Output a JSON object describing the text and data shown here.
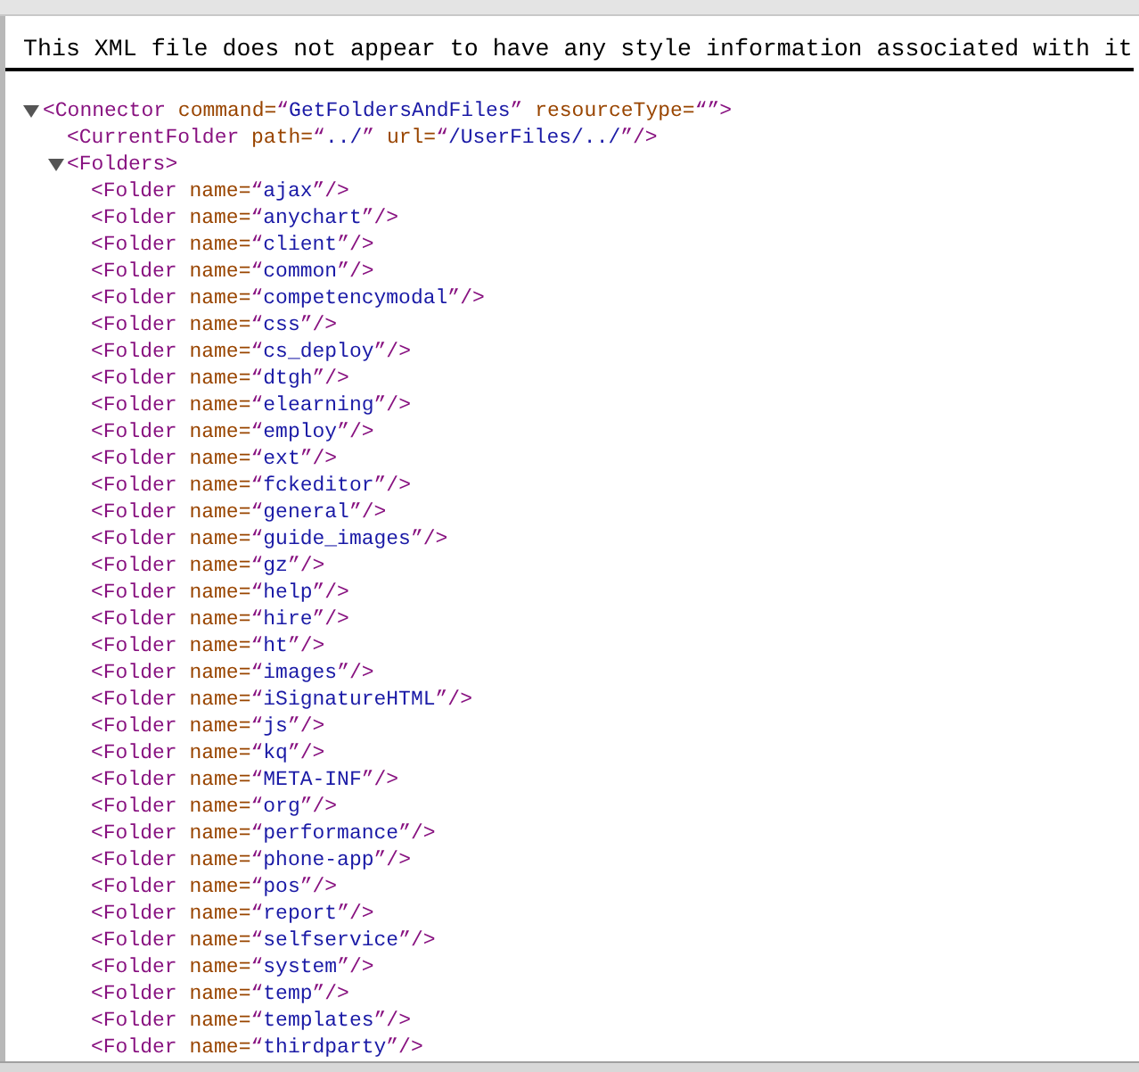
{
  "notice": "This XML file does not appear to have any style information associated with it",
  "tree": [
    {
      "expanded": true,
      "tokens": [
        {
          "kind": "tag",
          "text": "<Connector"
        },
        {
          "kind": "attr",
          "text": " command="
        },
        {
          "kind": "tag",
          "text": "“"
        },
        {
          "kind": "value",
          "text": "GetFoldersAndFiles"
        },
        {
          "kind": "tag",
          "text": "”"
        },
        {
          "kind": "attr",
          "text": " resourceType="
        },
        {
          "kind": "tag",
          "text": "“”>"
        }
      ],
      "children": [
        {
          "tokens": [
            {
              "kind": "tag",
              "text": "<CurrentFolder"
            },
            {
              "kind": "attr",
              "text": " path="
            },
            {
              "kind": "tag",
              "text": "“"
            },
            {
              "kind": "value",
              "text": "../"
            },
            {
              "kind": "tag",
              "text": "”"
            },
            {
              "kind": "attr",
              "text": " url="
            },
            {
              "kind": "tag",
              "text": "“"
            },
            {
              "kind": "value",
              "text": "/UserFiles/../"
            },
            {
              "kind": "tag",
              "text": "”/>"
            }
          ]
        },
        {
          "expanded": true,
          "tokens": [
            {
              "kind": "tag",
              "text": "<Folders>"
            }
          ],
          "children": [
            {
              "tokens": [
                {
                  "kind": "tag",
                  "text": "<Folder"
                },
                {
                  "kind": "attr",
                  "text": " name="
                },
                {
                  "kind": "tag",
                  "text": "“"
                },
                {
                  "kind": "value",
                  "text": "ajax"
                },
                {
                  "kind": "tag",
                  "text": "”/>"
                }
              ]
            },
            {
              "tokens": [
                {
                  "kind": "tag",
                  "text": "<Folder"
                },
                {
                  "kind": "attr",
                  "text": " name="
                },
                {
                  "kind": "tag",
                  "text": "“"
                },
                {
                  "kind": "value",
                  "text": "anychart"
                },
                {
                  "kind": "tag",
                  "text": "”/>"
                }
              ]
            },
            {
              "tokens": [
                {
                  "kind": "tag",
                  "text": "<Folder"
                },
                {
                  "kind": "attr",
                  "text": " name="
                },
                {
                  "kind": "tag",
                  "text": "“"
                },
                {
                  "kind": "value",
                  "text": "client"
                },
                {
                  "kind": "tag",
                  "text": "”/>"
                }
              ]
            },
            {
              "tokens": [
                {
                  "kind": "tag",
                  "text": "<Folder"
                },
                {
                  "kind": "attr",
                  "text": " name="
                },
                {
                  "kind": "tag",
                  "text": "“"
                },
                {
                  "kind": "value",
                  "text": "common"
                },
                {
                  "kind": "tag",
                  "text": "”/>"
                }
              ]
            },
            {
              "tokens": [
                {
                  "kind": "tag",
                  "text": "<Folder"
                },
                {
                  "kind": "attr",
                  "text": " name="
                },
                {
                  "kind": "tag",
                  "text": "“"
                },
                {
                  "kind": "value",
                  "text": "competencymodal"
                },
                {
                  "kind": "tag",
                  "text": "”/>"
                }
              ]
            },
            {
              "tokens": [
                {
                  "kind": "tag",
                  "text": "<Folder"
                },
                {
                  "kind": "attr",
                  "text": " name="
                },
                {
                  "kind": "tag",
                  "text": "“"
                },
                {
                  "kind": "value",
                  "text": "css"
                },
                {
                  "kind": "tag",
                  "text": "”/>"
                }
              ]
            },
            {
              "tokens": [
                {
                  "kind": "tag",
                  "text": "<Folder"
                },
                {
                  "kind": "attr",
                  "text": " name="
                },
                {
                  "kind": "tag",
                  "text": "“"
                },
                {
                  "kind": "value",
                  "text": "cs_deploy"
                },
                {
                  "kind": "tag",
                  "text": "”/>"
                }
              ]
            },
            {
              "tokens": [
                {
                  "kind": "tag",
                  "text": "<Folder"
                },
                {
                  "kind": "attr",
                  "text": " name="
                },
                {
                  "kind": "tag",
                  "text": "“"
                },
                {
                  "kind": "value",
                  "text": "dtgh"
                },
                {
                  "kind": "tag",
                  "text": "”/>"
                }
              ]
            },
            {
              "tokens": [
                {
                  "kind": "tag",
                  "text": "<Folder"
                },
                {
                  "kind": "attr",
                  "text": " name="
                },
                {
                  "kind": "tag",
                  "text": "“"
                },
                {
                  "kind": "value",
                  "text": "elearning"
                },
                {
                  "kind": "tag",
                  "text": "”/>"
                }
              ]
            },
            {
              "tokens": [
                {
                  "kind": "tag",
                  "text": "<Folder"
                },
                {
                  "kind": "attr",
                  "text": " name="
                },
                {
                  "kind": "tag",
                  "text": "“"
                },
                {
                  "kind": "value",
                  "text": "employ"
                },
                {
                  "kind": "tag",
                  "text": "”/>"
                }
              ]
            },
            {
              "tokens": [
                {
                  "kind": "tag",
                  "text": "<Folder"
                },
                {
                  "kind": "attr",
                  "text": " name="
                },
                {
                  "kind": "tag",
                  "text": "“"
                },
                {
                  "kind": "value",
                  "text": "ext"
                },
                {
                  "kind": "tag",
                  "text": "”/>"
                }
              ]
            },
            {
              "tokens": [
                {
                  "kind": "tag",
                  "text": "<Folder"
                },
                {
                  "kind": "attr",
                  "text": " name="
                },
                {
                  "kind": "tag",
                  "text": "“"
                },
                {
                  "kind": "value",
                  "text": "fckeditor"
                },
                {
                  "kind": "tag",
                  "text": "”/>"
                }
              ]
            },
            {
              "tokens": [
                {
                  "kind": "tag",
                  "text": "<Folder"
                },
                {
                  "kind": "attr",
                  "text": " name="
                },
                {
                  "kind": "tag",
                  "text": "“"
                },
                {
                  "kind": "value",
                  "text": "general"
                },
                {
                  "kind": "tag",
                  "text": "”/>"
                }
              ]
            },
            {
              "tokens": [
                {
                  "kind": "tag",
                  "text": "<Folder"
                },
                {
                  "kind": "attr",
                  "text": " name="
                },
                {
                  "kind": "tag",
                  "text": "“"
                },
                {
                  "kind": "value",
                  "text": "guide_images"
                },
                {
                  "kind": "tag",
                  "text": "”/>"
                }
              ]
            },
            {
              "tokens": [
                {
                  "kind": "tag",
                  "text": "<Folder"
                },
                {
                  "kind": "attr",
                  "text": " name="
                },
                {
                  "kind": "tag",
                  "text": "“"
                },
                {
                  "kind": "value",
                  "text": "gz"
                },
                {
                  "kind": "tag",
                  "text": "”/>"
                }
              ]
            },
            {
              "tokens": [
                {
                  "kind": "tag",
                  "text": "<Folder"
                },
                {
                  "kind": "attr",
                  "text": " name="
                },
                {
                  "kind": "tag",
                  "text": "“"
                },
                {
                  "kind": "value",
                  "text": "help"
                },
                {
                  "kind": "tag",
                  "text": "”/>"
                }
              ]
            },
            {
              "tokens": [
                {
                  "kind": "tag",
                  "text": "<Folder"
                },
                {
                  "kind": "attr",
                  "text": " name="
                },
                {
                  "kind": "tag",
                  "text": "“"
                },
                {
                  "kind": "value",
                  "text": "hire"
                },
                {
                  "kind": "tag",
                  "text": "”/>"
                }
              ]
            },
            {
              "tokens": [
                {
                  "kind": "tag",
                  "text": "<Folder"
                },
                {
                  "kind": "attr",
                  "text": " name="
                },
                {
                  "kind": "tag",
                  "text": "“"
                },
                {
                  "kind": "value",
                  "text": "ht"
                },
                {
                  "kind": "tag",
                  "text": "”/>"
                }
              ]
            },
            {
              "tokens": [
                {
                  "kind": "tag",
                  "text": "<Folder"
                },
                {
                  "kind": "attr",
                  "text": " name="
                },
                {
                  "kind": "tag",
                  "text": "“"
                },
                {
                  "kind": "value",
                  "text": "images"
                },
                {
                  "kind": "tag",
                  "text": "”/>"
                }
              ]
            },
            {
              "tokens": [
                {
                  "kind": "tag",
                  "text": "<Folder"
                },
                {
                  "kind": "attr",
                  "text": " name="
                },
                {
                  "kind": "tag",
                  "text": "“"
                },
                {
                  "kind": "value",
                  "text": "iSignatureHTML"
                },
                {
                  "kind": "tag",
                  "text": "”/>"
                }
              ]
            },
            {
              "tokens": [
                {
                  "kind": "tag",
                  "text": "<Folder"
                },
                {
                  "kind": "attr",
                  "text": " name="
                },
                {
                  "kind": "tag",
                  "text": "“"
                },
                {
                  "kind": "value",
                  "text": "js"
                },
                {
                  "kind": "tag",
                  "text": "”/>"
                }
              ]
            },
            {
              "tokens": [
                {
                  "kind": "tag",
                  "text": "<Folder"
                },
                {
                  "kind": "attr",
                  "text": " name="
                },
                {
                  "kind": "tag",
                  "text": "“"
                },
                {
                  "kind": "value",
                  "text": "kq"
                },
                {
                  "kind": "tag",
                  "text": "”/>"
                }
              ]
            },
            {
              "tokens": [
                {
                  "kind": "tag",
                  "text": "<Folder"
                },
                {
                  "kind": "attr",
                  "text": " name="
                },
                {
                  "kind": "tag",
                  "text": "“"
                },
                {
                  "kind": "value",
                  "text": "META-INF"
                },
                {
                  "kind": "tag",
                  "text": "”/>"
                }
              ]
            },
            {
              "tokens": [
                {
                  "kind": "tag",
                  "text": "<Folder"
                },
                {
                  "kind": "attr",
                  "text": " name="
                },
                {
                  "kind": "tag",
                  "text": "“"
                },
                {
                  "kind": "value",
                  "text": "org"
                },
                {
                  "kind": "tag",
                  "text": "”/>"
                }
              ]
            },
            {
              "tokens": [
                {
                  "kind": "tag",
                  "text": "<Folder"
                },
                {
                  "kind": "attr",
                  "text": " name="
                },
                {
                  "kind": "tag",
                  "text": "“"
                },
                {
                  "kind": "value",
                  "text": "performance"
                },
                {
                  "kind": "tag",
                  "text": "”/>"
                }
              ]
            },
            {
              "tokens": [
                {
                  "kind": "tag",
                  "text": "<Folder"
                },
                {
                  "kind": "attr",
                  "text": " name="
                },
                {
                  "kind": "tag",
                  "text": "“"
                },
                {
                  "kind": "value",
                  "text": "phone-app"
                },
                {
                  "kind": "tag",
                  "text": "”/>"
                }
              ]
            },
            {
              "tokens": [
                {
                  "kind": "tag",
                  "text": "<Folder"
                },
                {
                  "kind": "attr",
                  "text": " name="
                },
                {
                  "kind": "tag",
                  "text": "“"
                },
                {
                  "kind": "value",
                  "text": "pos"
                },
                {
                  "kind": "tag",
                  "text": "”/>"
                }
              ]
            },
            {
              "tokens": [
                {
                  "kind": "tag",
                  "text": "<Folder"
                },
                {
                  "kind": "attr",
                  "text": " name="
                },
                {
                  "kind": "tag",
                  "text": "“"
                },
                {
                  "kind": "value",
                  "text": "report"
                },
                {
                  "kind": "tag",
                  "text": "”/>"
                }
              ]
            },
            {
              "tokens": [
                {
                  "kind": "tag",
                  "text": "<Folder"
                },
                {
                  "kind": "attr",
                  "text": " name="
                },
                {
                  "kind": "tag",
                  "text": "“"
                },
                {
                  "kind": "value",
                  "text": "selfservice"
                },
                {
                  "kind": "tag",
                  "text": "”/>"
                }
              ]
            },
            {
              "tokens": [
                {
                  "kind": "tag",
                  "text": "<Folder"
                },
                {
                  "kind": "attr",
                  "text": " name="
                },
                {
                  "kind": "tag",
                  "text": "“"
                },
                {
                  "kind": "value",
                  "text": "system"
                },
                {
                  "kind": "tag",
                  "text": "”/>"
                }
              ]
            },
            {
              "tokens": [
                {
                  "kind": "tag",
                  "text": "<Folder"
                },
                {
                  "kind": "attr",
                  "text": " name="
                },
                {
                  "kind": "tag",
                  "text": "“"
                },
                {
                  "kind": "value",
                  "text": "temp"
                },
                {
                  "kind": "tag",
                  "text": "”/>"
                }
              ]
            },
            {
              "tokens": [
                {
                  "kind": "tag",
                  "text": "<Folder"
                },
                {
                  "kind": "attr",
                  "text": " name="
                },
                {
                  "kind": "tag",
                  "text": "“"
                },
                {
                  "kind": "value",
                  "text": "templates"
                },
                {
                  "kind": "tag",
                  "text": "”/>"
                }
              ]
            },
            {
              "tokens": [
                {
                  "kind": "tag",
                  "text": "<Folder"
                },
                {
                  "kind": "attr",
                  "text": " name="
                },
                {
                  "kind": "tag",
                  "text": "“"
                },
                {
                  "kind": "value",
                  "text": "thirdparty"
                },
                {
                  "kind": "tag",
                  "text": "”/>"
                }
              ]
            }
          ]
        }
      ]
    }
  ]
}
